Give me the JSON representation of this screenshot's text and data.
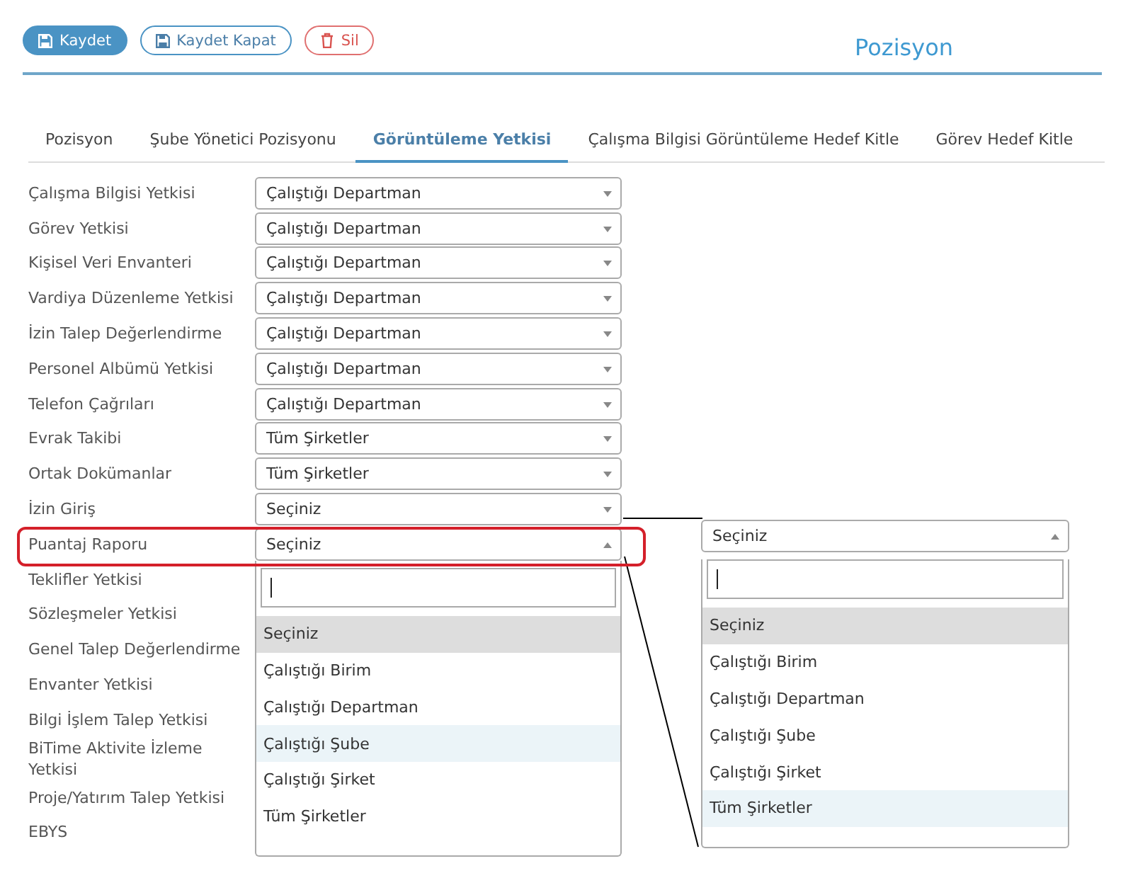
{
  "toolbar": {
    "buttons": [
      {
        "label": "Kaydet",
        "kind": "primary"
      },
      {
        "label": "Kaydet Kapat",
        "kind": "secondary"
      },
      {
        "label": "Sil",
        "kind": "danger"
      }
    ]
  },
  "page_title": "Pozisyon",
  "tabs": [
    {
      "label": "Pozisyon",
      "selected": false
    },
    {
      "label": "Şube Yönetici Pozisyonu",
      "selected": false
    },
    {
      "label": "Görüntüleme Yetkisi",
      "selected": true
    },
    {
      "label": "Çalışma Bilgisi Görüntüleme Hedef Kitle",
      "selected": false
    },
    {
      "label": "Görev Hedef Kitle",
      "selected": false
    }
  ],
  "fields": [
    {
      "label": "Çalışma Bilgisi Yetkisi",
      "value": "Çalıştığı Departman",
      "open": false
    },
    {
      "label": "Görev Yetkisi",
      "value": "Çalıştığı Departman",
      "open": false
    },
    {
      "label": "Kişisel Veri Envanteri",
      "value": "Çalıştığı Departman",
      "open": false
    },
    {
      "label": "Vardiya Düzenleme Yetkisi",
      "value": "Çalıştığı Departman",
      "open": false
    },
    {
      "label": "İzin Talep Değerlendirme",
      "value": "Çalıştığı Departman",
      "open": false
    },
    {
      "label": "Personel Albümü Yetkisi",
      "value": "Çalıştığı Departman",
      "open": false
    },
    {
      "label": "Telefon Çağrıları",
      "value": "Çalıştığı Departman",
      "open": false
    },
    {
      "label": "Evrak Takibi",
      "value": "Tüm Şirketler",
      "open": false
    },
    {
      "label": "Ortak Dokümanlar",
      "value": "Tüm Şirketler",
      "open": false
    },
    {
      "label": "İzin Giriş",
      "value": "Seçiniz",
      "open": false
    },
    {
      "label": "Puantaj Raporu",
      "value": "Seçiniz",
      "open": true,
      "highlighted": true
    },
    {
      "label": "Teklifler Yetkisi"
    },
    {
      "label": "Sözleşmeler Yetkisi"
    },
    {
      "label": "Genel Talep Değerlendirme"
    },
    {
      "label": "Envanter Yetkisi"
    },
    {
      "label": "Bilgi İşlem Talep Yetkisi"
    },
    {
      "label": "BiTime Aktivite İzleme Yetkisi"
    },
    {
      "label": "Proje/Yatırım Talep Yetkisi"
    },
    {
      "label": "EBYS"
    }
  ],
  "dropdown": {
    "options": [
      {
        "label": "Seçiniz",
        "selected": true,
        "hovered": false
      },
      {
        "label": "Çalıştığı Birim",
        "selected": false,
        "hovered": false
      },
      {
        "label": "Çalıştığı Departman",
        "selected": false,
        "hovered": false
      },
      {
        "label": "Çalıştığı Şube",
        "selected": false,
        "hovered": true
      },
      {
        "label": "Çalıştığı Şirket",
        "selected": false,
        "hovered": false
      },
      {
        "label": "Tüm Şirketler",
        "selected": false,
        "hovered": false
      }
    ]
  },
  "callout": {
    "value": "Seçiniz",
    "open": true,
    "options": [
      {
        "label": "Seçiniz",
        "selected": true,
        "hovered": false
      },
      {
        "label": "Çalıştığı Birim",
        "selected": false,
        "hovered": false
      },
      {
        "label": "Çalıştığı Departman",
        "selected": false,
        "hovered": false
      },
      {
        "label": "Çalıştığı Şube",
        "selected": false,
        "hovered": false
      },
      {
        "label": "Çalıştığı Şirket",
        "selected": false,
        "hovered": false
      },
      {
        "label": "Tüm Şirketler",
        "selected": false,
        "hovered": true
      }
    ]
  }
}
